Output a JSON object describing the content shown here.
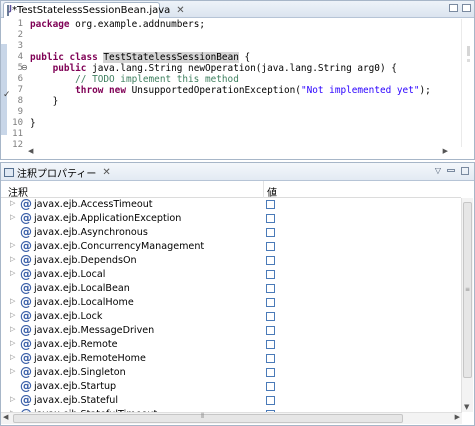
{
  "editor": {
    "tab_title": "*TestStatelessSessionBean.java",
    "tab_close": "✕",
    "line_numbers": [
      "1",
      "2",
      "3",
      "4",
      "5",
      "6",
      "7",
      "8",
      "9",
      "10",
      "11",
      "12"
    ],
    "fold_marker": "⊖",
    "task_marker": "✓",
    "code": {
      "l1_kw": "package",
      "l1_rest": " org.example.addnumbers;",
      "l4_kw1": "public",
      "l4_kw2": " class",
      "l4_sp": " ",
      "l4_name": "TestStatelessSessionBean",
      "l4_rest": " {",
      "l5_indent": "    ",
      "l5_kw": "public",
      "l5_rest": " java.lang.String newOperation(java.lang.String arg0) {",
      "l6_indent": "        ",
      "l6_comment": "// TODO implement this method",
      "l7_indent": "        ",
      "l7_kw1": "throw",
      "l7_kw2": " new",
      "l7_rest1": " UnsupportedOperationException(",
      "l7_str": "\"Not implemented yet\"",
      "l7_rest2": ");",
      "l8": "    }",
      "l10": "}"
    }
  },
  "view": {
    "tab_title": "注釈プロパティー",
    "tab_close": "✕",
    "tools": {
      "menu_icon": "▽"
    },
    "columns": {
      "annotation": "注釈",
      "value": "値"
    },
    "rows": [
      {
        "expand": "▷",
        "name": "javax.ejb.AccessTimeout"
      },
      {
        "expand": "▷",
        "name": "javax.ejb.ApplicationException"
      },
      {
        "expand": "",
        "name": "javax.ejb.Asynchronous"
      },
      {
        "expand": "▷",
        "name": "javax.ejb.ConcurrencyManagement"
      },
      {
        "expand": "▷",
        "name": "javax.ejb.DependsOn"
      },
      {
        "expand": "▷",
        "name": "javax.ejb.Local"
      },
      {
        "expand": "",
        "name": "javax.ejb.LocalBean"
      },
      {
        "expand": "▷",
        "name": "javax.ejb.LocalHome"
      },
      {
        "expand": "▷",
        "name": "javax.ejb.Lock"
      },
      {
        "expand": "▷",
        "name": "javax.ejb.MessageDriven"
      },
      {
        "expand": "▷",
        "name": "javax.ejb.Remote"
      },
      {
        "expand": "▷",
        "name": "javax.ejb.RemoteHome"
      },
      {
        "expand": "▷",
        "name": "javax.ejb.Singleton"
      },
      {
        "expand": "",
        "name": "javax.ejb.Startup"
      },
      {
        "expand": "▷",
        "name": "javax.ejb.Stateful"
      },
      {
        "expand": "▷",
        "name": "javax.ejb.StatefulTimeout"
      }
    ],
    "annotation_icon": "@"
  }
}
